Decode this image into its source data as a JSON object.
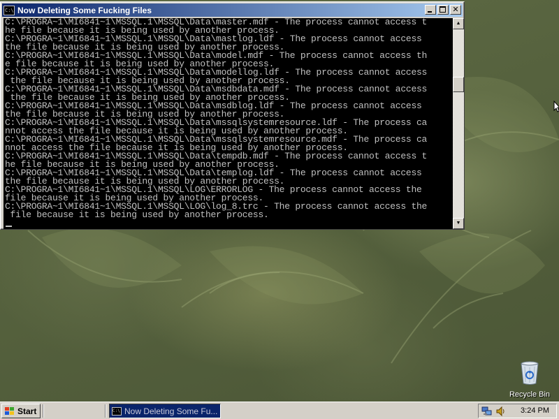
{
  "window": {
    "title": "Now Deleting Some Fucking Files",
    "icon": "console-icon",
    "icon_text": "C:\\",
    "buttons": {
      "minimize": "minimize-icon",
      "maximize": "maximize-icon",
      "close": "✕"
    }
  },
  "console": {
    "lines": [
      "C:\\PROGRA~1\\MI6841~1\\MSSQL.1\\MSSQL\\Data\\master.mdf - The process cannot access t",
      "he file because it is being used by another process.",
      "C:\\PROGRA~1\\MI6841~1\\MSSQL.1\\MSSQL\\Data\\mastlog.ldf - The process cannot access",
      "the file because it is being used by another process.",
      "C:\\PROGRA~1\\MI6841~1\\MSSQL.1\\MSSQL\\Data\\model.mdf - The process cannot access th",
      "e file because it is being used by another process.",
      "C:\\PROGRA~1\\MI6841~1\\MSSQL.1\\MSSQL\\Data\\modellog.ldf - The process cannot access",
      " the file because it is being used by another process.",
      "C:\\PROGRA~1\\MI6841~1\\MSSQL.1\\MSSQL\\Data\\msdbdata.mdf - The process cannot access",
      " the file because it is being used by another process.",
      "C:\\PROGRA~1\\MI6841~1\\MSSQL.1\\MSSQL\\Data\\msdblog.ldf - The process cannot access",
      "the file because it is being used by another process.",
      "C:\\PROGRA~1\\MI6841~1\\MSSQL.1\\MSSQL\\Data\\mssqlsystemresource.ldf - The process ca",
      "nnot access the file because it is being used by another process.",
      "C:\\PROGRA~1\\MI6841~1\\MSSQL.1\\MSSQL\\Data\\mssqlsystemresource.mdf - The process ca",
      "nnot access the file because it is being used by another process.",
      "C:\\PROGRA~1\\MI6841~1\\MSSQL.1\\MSSQL\\Data\\tempdb.mdf - The process cannot access t",
      "he file because it is being used by another process.",
      "C:\\PROGRA~1\\MI6841~1\\MSSQL.1\\MSSQL\\Data\\templog.ldf - The process cannot access",
      "the file because it is being used by another process.",
      "C:\\PROGRA~1\\MI6841~1\\MSSQL.1\\MSSQL\\LOG\\ERRORLOG - The process cannot access the",
      "file because it is being used by another process.",
      "C:\\PROGRA~1\\MI6841~1\\MSSQL.1\\MSSQL\\LOG\\log_8.trc - The process cannot access the",
      " file because it is being used by another process."
    ],
    "text_color": "#c0c0c0",
    "background_color": "#000000"
  },
  "scrollbar": {
    "up_arrow": "▲",
    "down_arrow": "▼"
  },
  "desktop": {
    "recycle_bin": {
      "label": "Recycle Bin",
      "icon": "recycle-bin-icon"
    }
  },
  "taskbar": {
    "start_label": "Start",
    "start_icon": "windows-logo-icon",
    "task_button": {
      "label": "Now Deleting Some Fu...",
      "icon": "console-icon",
      "icon_text": "C:\\"
    },
    "tray_icons": [
      "network-icon",
      "volume-icon"
    ],
    "clock": "3:24 PM"
  },
  "colors": {
    "title_bar_start": "#0a246a",
    "title_bar_end": "#a6caf0",
    "chrome": "#d4d0c8",
    "desktop": "#56623e"
  }
}
